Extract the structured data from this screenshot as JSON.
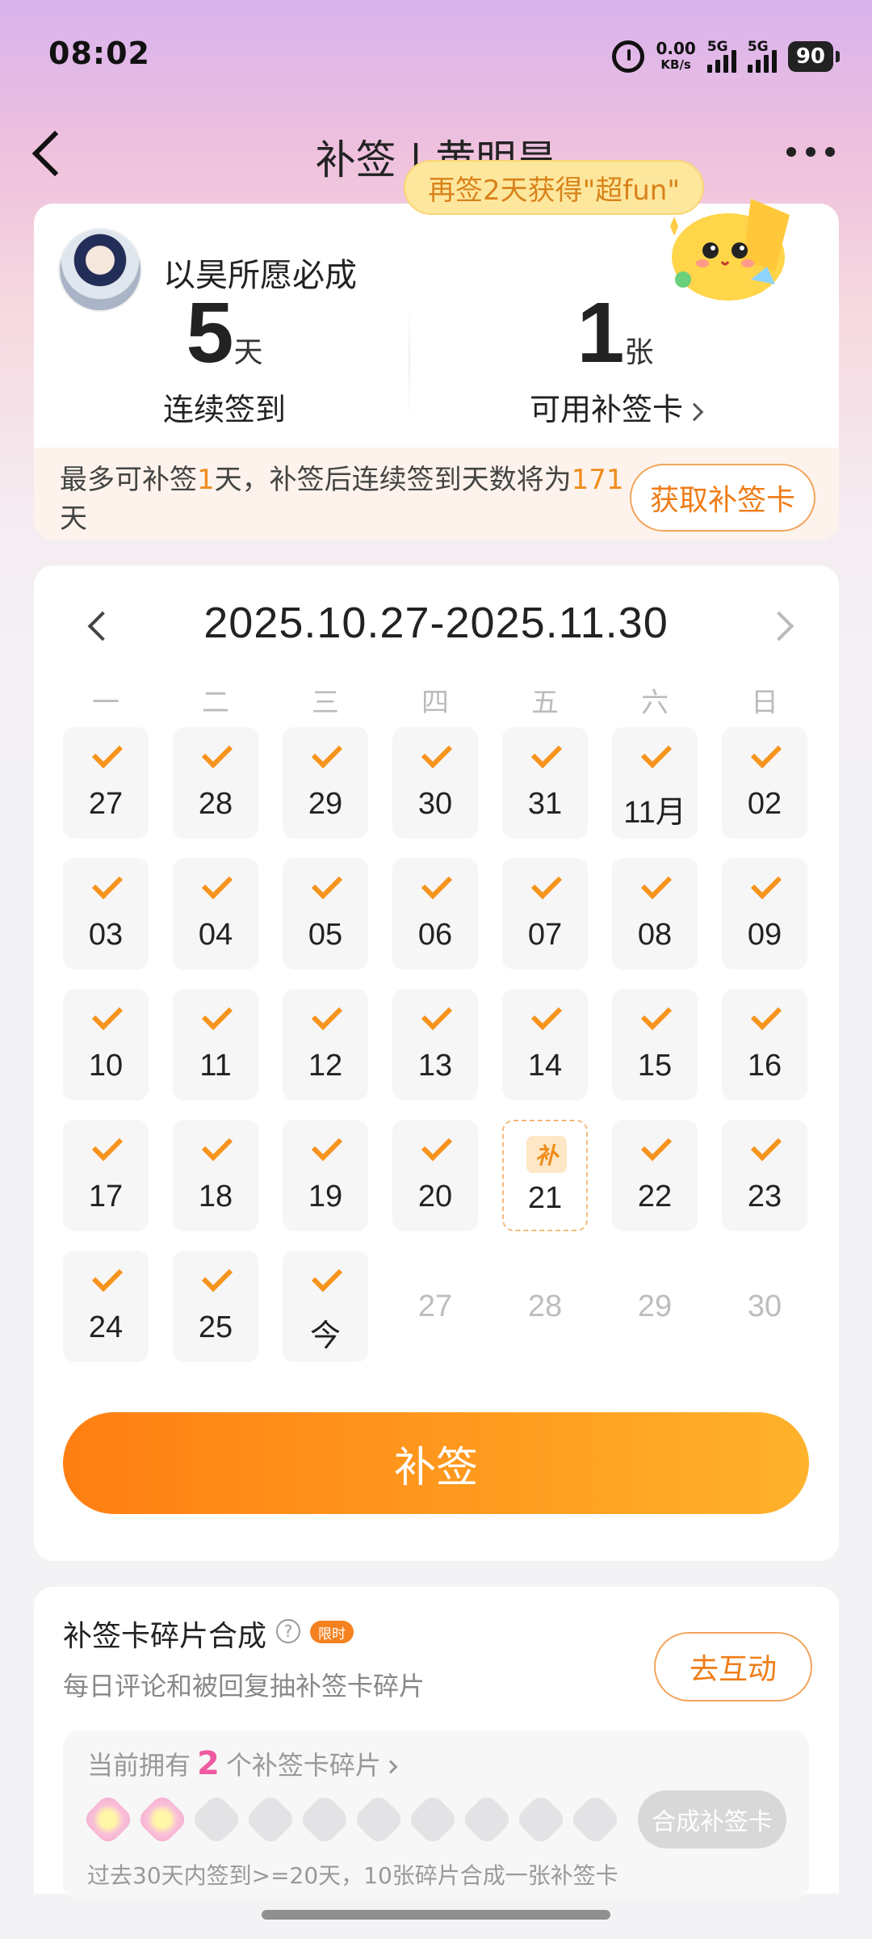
{
  "status_bar": {
    "time": "08:02",
    "net_speed": "0.00",
    "net_unit": "KB/s",
    "sim1": "5G",
    "sim2": "5G",
    "battery": "90"
  },
  "nav": {
    "title": "补签 | 黄明昊"
  },
  "bubble": "再签2天获得\"超fun\"",
  "user": {
    "name": "以昊所愿必成",
    "streak_value": "5",
    "streak_unit": "天",
    "streak_label": "连续签到",
    "cards_value": "1",
    "cards_unit": "张",
    "cards_label": "可用补签卡"
  },
  "info": {
    "t1": "最多可补签",
    "days": "1",
    "t2": "天，补签后连续签到天数将为",
    "total": "171",
    "t3": "天",
    "get_card_button": "获取补签卡"
  },
  "calendar": {
    "range": "2025.10.27-2025.11.30",
    "weekdays": [
      "一",
      "二",
      "三",
      "四",
      "五",
      "六",
      "日"
    ],
    "days": [
      {
        "label": "27",
        "state": "signed"
      },
      {
        "label": "28",
        "state": "signed"
      },
      {
        "label": "29",
        "state": "signed"
      },
      {
        "label": "30",
        "state": "signed"
      },
      {
        "label": "31",
        "state": "signed"
      },
      {
        "label": "11月",
        "state": "signed"
      },
      {
        "label": "02",
        "state": "signed"
      },
      {
        "label": "03",
        "state": "signed"
      },
      {
        "label": "04",
        "state": "signed"
      },
      {
        "label": "05",
        "state": "signed"
      },
      {
        "label": "06",
        "state": "signed"
      },
      {
        "label": "07",
        "state": "signed"
      },
      {
        "label": "08",
        "state": "signed"
      },
      {
        "label": "09",
        "state": "signed"
      },
      {
        "label": "10",
        "state": "signed"
      },
      {
        "label": "11",
        "state": "signed"
      },
      {
        "label": "12",
        "state": "signed"
      },
      {
        "label": "13",
        "state": "signed"
      },
      {
        "label": "14",
        "state": "signed"
      },
      {
        "label": "15",
        "state": "signed"
      },
      {
        "label": "16",
        "state": "signed"
      },
      {
        "label": "17",
        "state": "signed"
      },
      {
        "label": "18",
        "state": "signed"
      },
      {
        "label": "19",
        "state": "signed"
      },
      {
        "label": "20",
        "state": "signed"
      },
      {
        "label": "21",
        "state": "makeup",
        "tag": "补"
      },
      {
        "label": "22",
        "state": "signed"
      },
      {
        "label": "23",
        "state": "signed"
      },
      {
        "label": "24",
        "state": "signed"
      },
      {
        "label": "25",
        "state": "signed"
      },
      {
        "label": "今",
        "state": "signed"
      },
      {
        "label": "27",
        "state": "future"
      },
      {
        "label": "28",
        "state": "future"
      },
      {
        "label": "29",
        "state": "future"
      },
      {
        "label": "30",
        "state": "future"
      }
    ],
    "sign_button": "补签"
  },
  "fragments": {
    "title": "补签卡碎片合成",
    "help": "?",
    "badge": "限时",
    "subtitle": "每日评论和被回复抽补签卡碎片",
    "interact_button": "去互动",
    "own_prefix": "当前拥有",
    "own_count": "2",
    "own_suffix": "个补签卡碎片",
    "collected": 2,
    "total_slots": 10,
    "compose_button": "合成补签卡",
    "rule": "过去30天内签到>=20天，10张碎片合成一张补签卡"
  }
}
